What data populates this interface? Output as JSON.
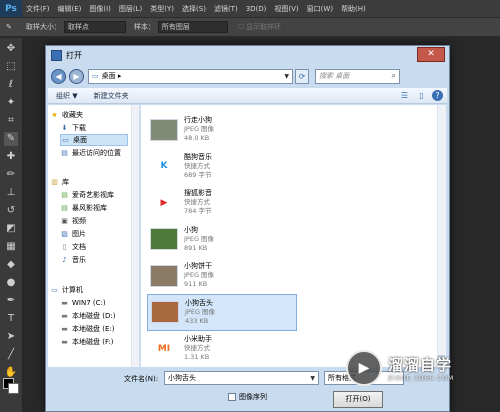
{
  "app": {
    "logo": "Ps",
    "menus": [
      "文件(F)",
      "编辑(E)",
      "图像(I)",
      "图层(L)",
      "类型(Y)",
      "选择(S)",
      "滤镜(T)",
      "3D(D)",
      "视图(V)",
      "窗口(W)",
      "帮助(H)"
    ]
  },
  "options": {
    "sample_size_label": "取样大小：",
    "sample_size_value": "取样点",
    "sample_label": "样本：",
    "sample_value": "所有图层",
    "show_ring_label": "显示取样环"
  },
  "dialog": {
    "title": "打开",
    "close_glyph": "✕",
    "address": "桌面 ▸",
    "search_placeholder": "搜索 桌面",
    "commands": {
      "organize": "组织 ▼",
      "new_folder": "新建文件夹"
    },
    "nav": {
      "favorites_header": "收藏夹",
      "favorites": [
        "下载",
        "桌面",
        "最近访问的位置"
      ],
      "library_header": "库",
      "libraries": [
        "爱奇艺影视库",
        "暴风影视库",
        "视频",
        "图片",
        "文档",
        "音乐"
      ],
      "computer_header": "计算机",
      "drives": [
        "WIN7 (C:)",
        "本地磁盘 (D:)",
        "本地磁盘 (E:)",
        "本地磁盘 (F:)"
      ]
    },
    "files": [
      {
        "name": "行走小狗",
        "type": "JPEG 图像",
        "size": "48.0 KB",
        "thumb": "dog1",
        "color": "#7f8b72"
      },
      {
        "name": "酷狗音乐",
        "type": "快捷方式",
        "size": "689 字节",
        "thumb": "K",
        "color": "#1f8fe0"
      },
      {
        "name": "搜狐影音",
        "type": "快捷方式",
        "size": "784 字节",
        "thumb": "▶",
        "color": "#e02a2a"
      },
      {
        "name": "小狗",
        "type": "JPEG 图像",
        "size": "891 KB",
        "thumb": "dog2",
        "color": "#4f7a3a"
      },
      {
        "name": "小狗饼干",
        "type": "JPEG 图像",
        "size": "911 KB",
        "thumb": "dog3",
        "color": "#8a7a66"
      },
      {
        "name": "小狗舌头",
        "type": "JPEG 图像",
        "size": "433 KB",
        "thumb": "dog4",
        "color": "#a86a40"
      },
      {
        "name": "小米助手",
        "type": "快捷方式",
        "size": "1.31 KB",
        "thumb": "MI",
        "color": "#f26b1d"
      }
    ],
    "filename_label": "文件名(N):",
    "filename_value": "小狗舌头",
    "filetype_value": "所有格式",
    "image_sequence_label": "图像序列",
    "open_label": "打开(O)"
  },
  "watermark": {
    "title": "溜溜自学",
    "url": "ZIXUE.3D66.COM"
  }
}
